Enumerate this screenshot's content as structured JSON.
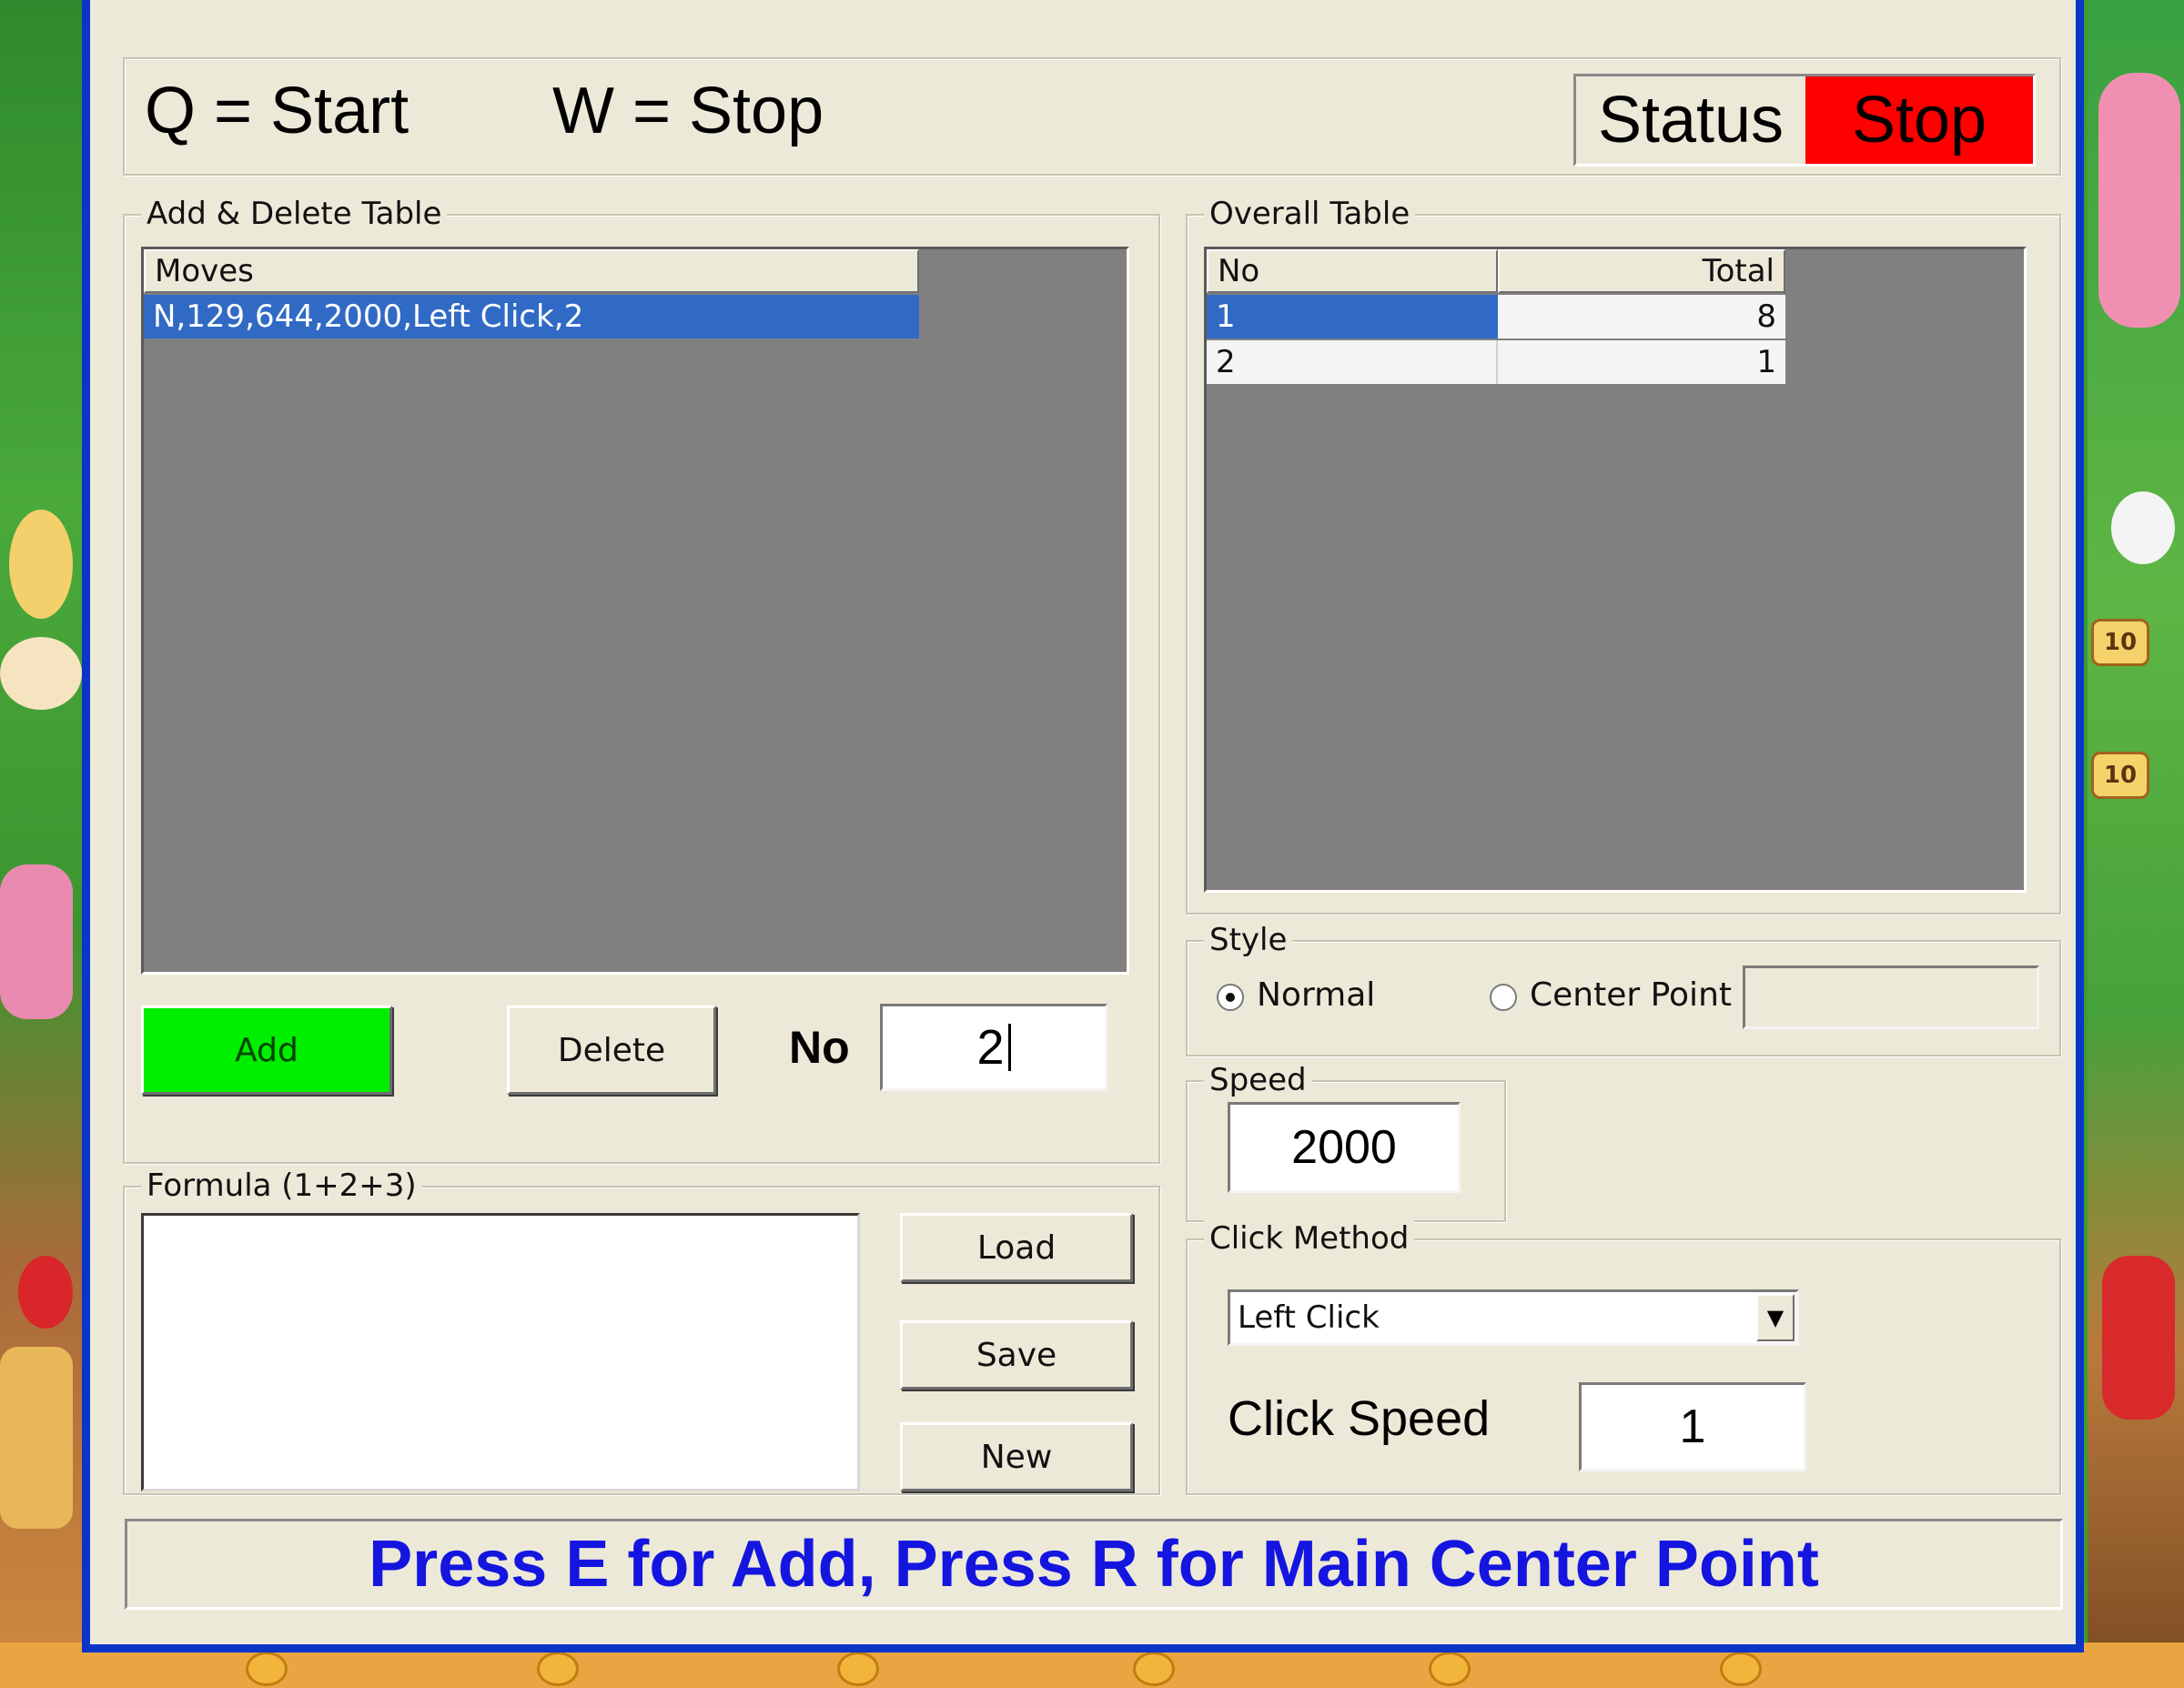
{
  "hotkeys": {
    "start": "Q = Start",
    "stop": "W = Stop"
  },
  "status": {
    "label": "Status",
    "value": "Stop",
    "value_color": "#ff0000"
  },
  "add_delete": {
    "legend": "Add & Delete Table",
    "column": "Moves",
    "rows": [
      "N,129,644,2000,Left Click,2"
    ],
    "add_label": "Add",
    "delete_label": "Delete",
    "no_label": "No",
    "no_value": "2"
  },
  "overall": {
    "legend": "Overall Table",
    "columns": [
      "No",
      "Total"
    ],
    "rows": [
      {
        "no": "1",
        "total": "8"
      },
      {
        "no": "2",
        "total": "1"
      }
    ]
  },
  "style": {
    "legend": "Style",
    "options": [
      "Normal",
      "Center Point"
    ],
    "selected": "Normal",
    "center_value": ""
  },
  "speed": {
    "legend": "Speed",
    "value": "2000"
  },
  "click_method": {
    "legend": "Click Method",
    "selected": "Left Click",
    "click_speed_label": "Click Speed",
    "click_speed_value": "1"
  },
  "formula": {
    "legend": "Formula (1+2+3)",
    "value": "",
    "load_label": "Load",
    "save_label": "Save",
    "new_label": "New"
  },
  "hint": "Press E for Add, Press R for Main Center Point",
  "colors": {
    "accent": "#0b35c8",
    "selection": "#316ac5",
    "add_button": "#00ee00",
    "hint_text": "#1515e0"
  },
  "background": {
    "badges": [
      "10",
      "10"
    ]
  }
}
